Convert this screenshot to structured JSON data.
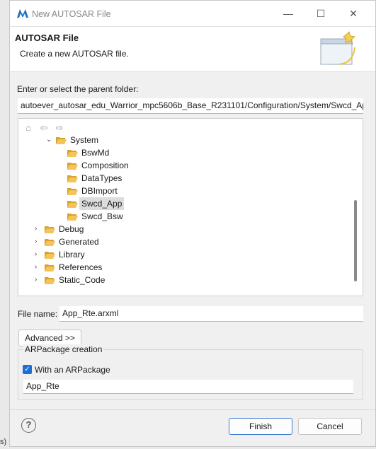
{
  "window": {
    "title": "New AUTOSAR File",
    "controls": {
      "minimize": "—",
      "maximize": "☐",
      "close": "✕"
    }
  },
  "banner": {
    "title": "AUTOSAR File",
    "description": "Create a new AUTOSAR file."
  },
  "parent_folder": {
    "label": "Enter or select the parent folder:",
    "value": "autoever_autosar_edu_Warrior_mpc5606b_Base_R231101/Configuration/System/Swcd_Ap"
  },
  "tree_toolbar": {
    "home": "⌂",
    "back": "⇦",
    "forward": "⇨"
  },
  "tree": {
    "system": "System",
    "children": [
      "BswMd",
      "Composition",
      "DataTypes",
      "DBImport",
      "Swcd_App",
      "Swcd_Bsw"
    ],
    "siblings": [
      "Debug",
      "Generated",
      "Library",
      "References",
      "Static_Code"
    ],
    "selected": "Swcd_App"
  },
  "file_name": {
    "label": "File name:",
    "value": "App_Rte.arxml"
  },
  "advanced_button": "Advanced >>",
  "arpackage": {
    "group_title": "ARPackage creation",
    "checkbox_label": "With an ARPackage",
    "checked": true,
    "value": "App_Rte"
  },
  "buttons": {
    "finish": "Finish",
    "cancel": "Cancel",
    "help": "?"
  },
  "edge_text": "s)",
  "colors": {
    "accent": "#1f6fd1",
    "folder": "#e8b341"
  }
}
